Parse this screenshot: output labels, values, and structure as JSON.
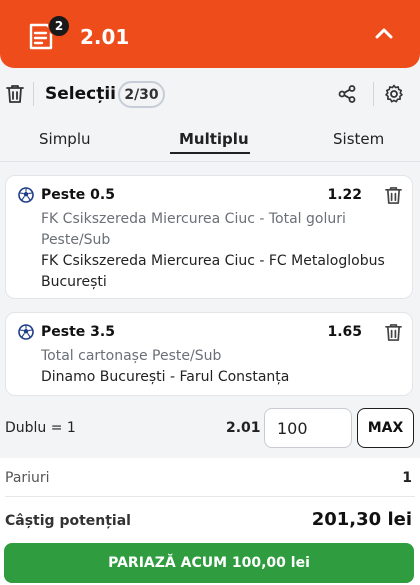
{
  "header": {
    "badge_count": "2",
    "total_odds": "2.01"
  },
  "toolbar": {
    "title": "Selecții",
    "selection_count": "2/30"
  },
  "tabs": [
    {
      "label": "Simplu"
    },
    {
      "label": "Multiplu",
      "active": true
    },
    {
      "label": "Sistem"
    }
  ],
  "selections": [
    {
      "pick": "Peste 0.5",
      "odds": "1.22",
      "market": "FK Csikszereda Miercurea Ciuc - Total goluri Peste/Sub",
      "event": "FK Csikszereda Miercurea Ciuc - FC Metaloglobus București"
    },
    {
      "pick": "Peste 3.5",
      "odds": "1.65",
      "market": "Total cartonașe Peste/Sub",
      "event": "Dinamo București - Farul Constanța"
    }
  ],
  "stake": {
    "combo_label": "Dublu = 1",
    "combo_odds": "2.01",
    "amount": "100",
    "max_label": "MAX"
  },
  "summary": {
    "bets_label": "Pariuri",
    "bets_value": "1",
    "win_label": "Câștig potențial",
    "win_value": "201,30 lei",
    "place_label": "PARIAZĂ ACUM 100,00 lei"
  },
  "colors": {
    "brand": "#ef4c1b",
    "place_button": "#2e9c3f"
  }
}
